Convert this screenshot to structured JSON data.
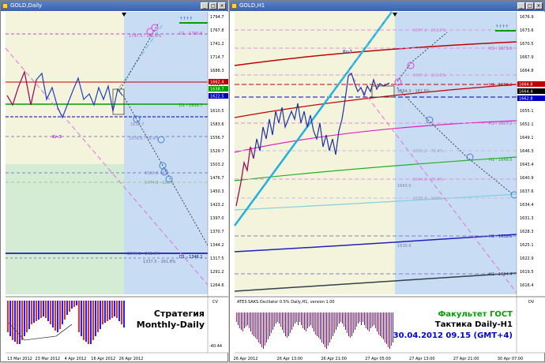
{
  "left_window": {
    "title": "GOLD,Daily",
    "price_axis": [
      "1794.7",
      "1767.8",
      "1741.2",
      "1714.7",
      "1688.3",
      "1662.4",
      "1636.2",
      "1610.5",
      "1583.6",
      "1556.7",
      "1529.7",
      "1503.2",
      "1476.7",
      "1450.3",
      "1423.2",
      "1397.0",
      "1370.7",
      "1344.2",
      "1317.5",
      "1291.2",
      "1264.6"
    ],
    "current_price": "1662.4",
    "badges": [
      {
        "text": "1662.4",
        "color": "#c00000"
      },
      {
        "text": "1638.7",
        "color": "#00a000"
      },
      {
        "text": "1622.5",
        "color": "#0000c0"
      }
    ],
    "dates": [
      "13 Mar 2012",
      "23 Mar 2012",
      "4 Apr 2012",
      "16 Apr 2012",
      "26 Apr 2012"
    ],
    "labels": {
      "kr": "Kr-3",
      "d1_top": "D1 - 1790.6",
      "fib_top": "1797.5 - 261.8%",
      "fib_mid": "1638.7",
      "d1_mid": "D1 - 1638.7",
      "d1_bottom": "D1 - 1346.1",
      "fib_b1": "1346.1 - 261.8%",
      "fib_b2": "1337.5 - 161.8%",
      "fib_l1": "1576.6 - 76.4%",
      "fib_l2": "1523.0 - 0%",
      "fib_l3": "1474.9 - 100%"
    },
    "osc_axis_top": "CV",
    "osc_axis_bottom": "-40.44",
    "strategy_line1": "Стратегия",
    "strategy_line2": "Monthly-Daily"
  },
  "right_window": {
    "title": "GOLD,H1",
    "price_axis": [
      "1676.9",
      "1673.6",
      "1670.5",
      "1667.9",
      "1664.8",
      "1661.7",
      "1658.5",
      "1655.1",
      "1652.1",
      "1649.1",
      "1646.3",
      "1643.4",
      "1640.9",
      "1637.6",
      "1634.4",
      "1631.3",
      "1628.3",
      "1625.1",
      "1622.9",
      "1619.5",
      "1616.4"
    ],
    "badges": [
      {
        "text": "1664.8",
        "color": "#c00000"
      },
      {
        "text": "1664.4",
        "color": "#000000"
      },
      {
        "text": "1662.8",
        "color": "#0000c0"
      }
    ],
    "dates": [
      "26 Apr 2012",
      "26 Apr 13:00",
      "26 Apr 21:00",
      "27 Apr 05:00",
      "27 Apr 13:00",
      "27 Apr 21:00",
      "30 Apr 07:00"
    ],
    "labels": {
      "kr": "Kr-3",
      "h1_1": "H1 - 1673.6",
      "h1_2": "H1 - 1666.9",
      "h1_3": "H1 - 1657.2",
      "h1_4": "H1 - 1649.0",
      "h1_5": "H1 - 1632.6",
      "h1_6": "H1 - 1624.4",
      "fib_1": "1677.2 - 261.8%",
      "fib_2": "1667.2 - 161.8%",
      "fib_3": "1664.3 - 161.8%",
      "fib_4": "1660.2 - 161.8%",
      "fib_5": "1650.2 - 76.4%",
      "fib_6": "1644.0 - 76.4%",
      "fib_7": "1643.0",
      "fib_8": "1638.0 - 100%",
      "fib_9": "1630.6"
    },
    "osc_title": "ATE3.SAKS.Oscillator 0.5% Daily,H1, version 1.00",
    "osc_axis_top": "DV",
    "faculty": "Факультет ГОСТ",
    "tactic": "Тактика Daily-H1",
    "datetime": "30.04.2012 09.15 (GMT+4)"
  },
  "colors": {
    "blue_fill": "#c8dcf4",
    "cream_fill": "#f4f4dc",
    "green_fill": "#d4ecd4",
    "osc_red": "#ff2020",
    "osc_blue": "#2020ff",
    "green_text": "#00a000"
  }
}
